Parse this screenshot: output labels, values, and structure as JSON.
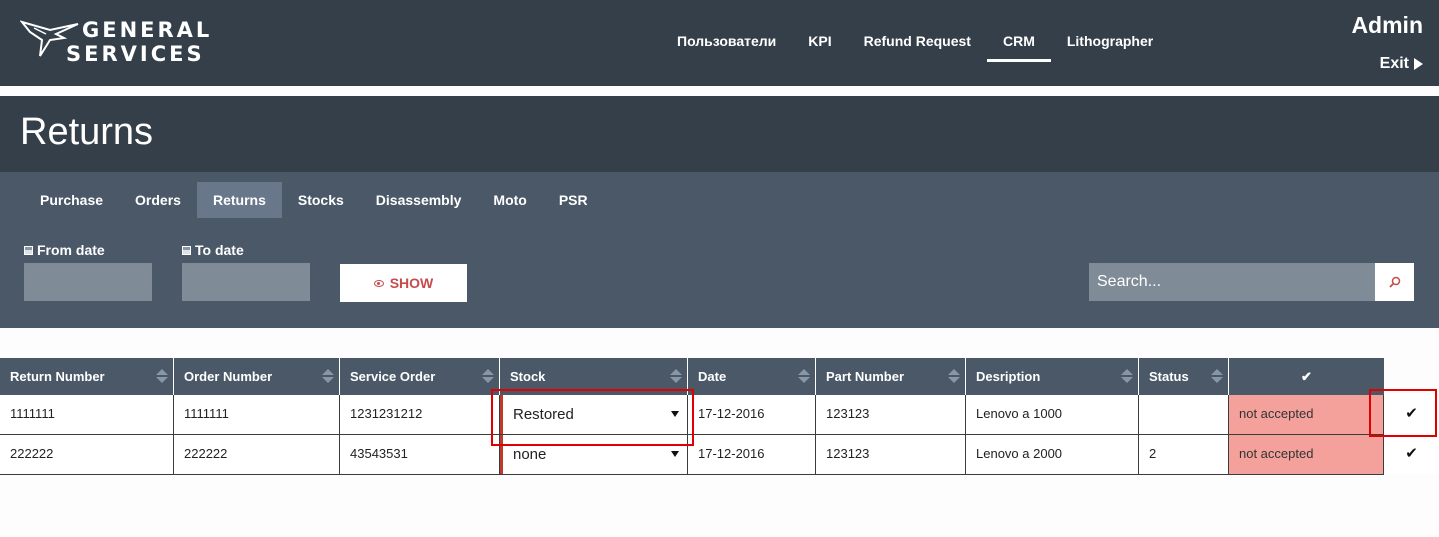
{
  "header": {
    "logo_line1": "GENERAL",
    "logo_line2": "SERVICES",
    "nav": [
      {
        "label": "Пользователи"
      },
      {
        "label": "KPI"
      },
      {
        "label": "Refund Request"
      },
      {
        "label": "CRM",
        "active": true
      },
      {
        "label": "Lithographer"
      }
    ],
    "user": "Admin",
    "exit_label": "Exit"
  },
  "page": {
    "title": "Returns"
  },
  "tabs": [
    {
      "label": "Purchase"
    },
    {
      "label": "Orders"
    },
    {
      "label": "Returns",
      "active": true
    },
    {
      "label": "Stocks"
    },
    {
      "label": "Disassembly"
    },
    {
      "label": "Moto"
    },
    {
      "label": "PSR"
    }
  ],
  "filters": {
    "from_label": "From date",
    "to_label": "To date",
    "from_value": "",
    "to_value": "",
    "show_label": "SHOW",
    "search_placeholder": "Search..."
  },
  "table": {
    "columns": [
      "Return Number",
      "Order Number",
      "Service Order",
      "Stock",
      "Date",
      "Part Number",
      "Desription",
      "Status",
      "✔"
    ],
    "rows": [
      {
        "return_number": "1111111",
        "order_number": "1111111",
        "service_order": "1231231212",
        "stock": "Restored",
        "date": "17-12-2016",
        "part_number": "123123",
        "description": "Lenovo a 1000",
        "status": "",
        "state": "not accepted",
        "check": "✔"
      },
      {
        "return_number": "222222",
        "order_number": "222222",
        "service_order": "43543531",
        "stock": "none",
        "date": "17-12-2016",
        "part_number": "123123",
        "description": "Lenovo a 2000",
        "status": "2",
        "state": "not accepted",
        "check": "✔"
      }
    ]
  },
  "colors": {
    "header": "#343f4a",
    "panel": "#4a5868",
    "status_bg": "#f4a19c",
    "accent": "#c54c4c",
    "highlight": "#e00000"
  }
}
